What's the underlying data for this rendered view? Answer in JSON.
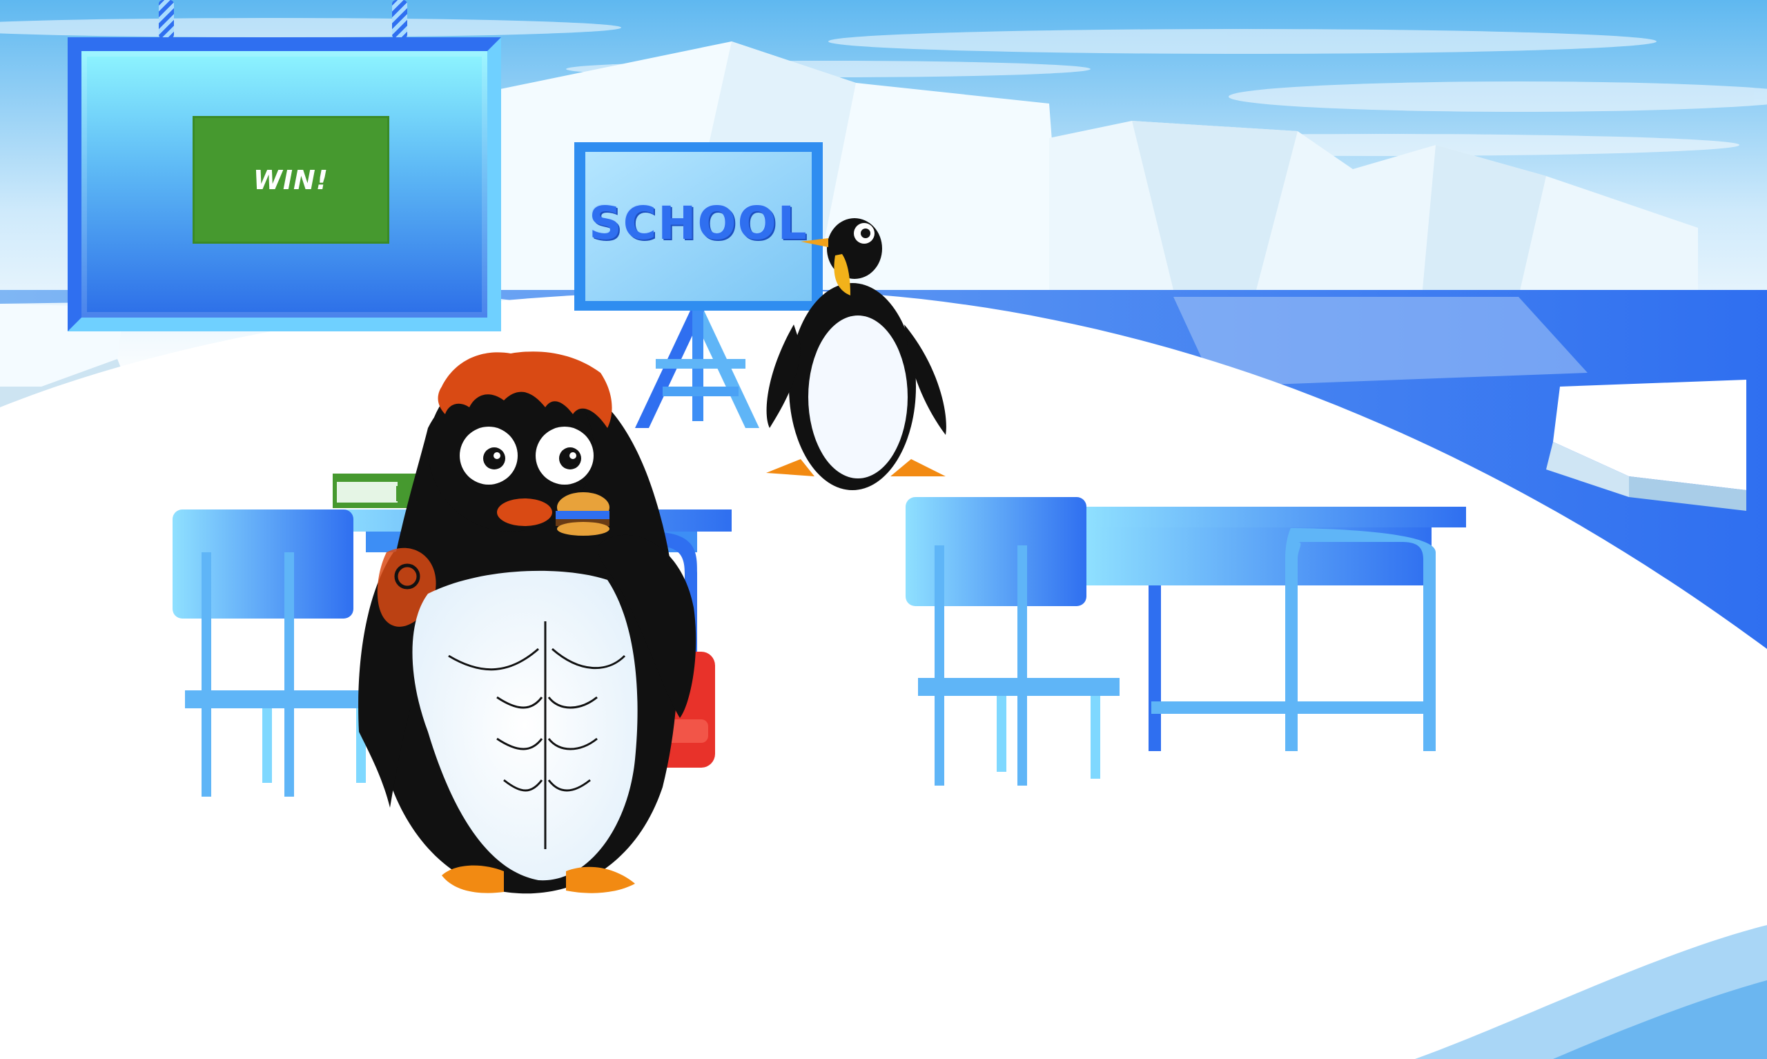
{
  "scene": {
    "win_button_label": "WIN!",
    "blackboard_label": "SCHOOL"
  },
  "colors": {
    "sky": "#5fb8f0",
    "sea": "#2f6ff0",
    "ice": "#ffffff",
    "win_button": "#46992f",
    "desk_blue": "#3d8ef5",
    "backpack_red": "#e8322a",
    "hair_orange": "#d94a14"
  },
  "icons": [
    "muscular-penguin-character",
    "penguin-teacher",
    "blackboard-easel",
    "hamburger",
    "school-desk",
    "school-chair",
    "backpack",
    "book",
    "iceberg"
  ]
}
